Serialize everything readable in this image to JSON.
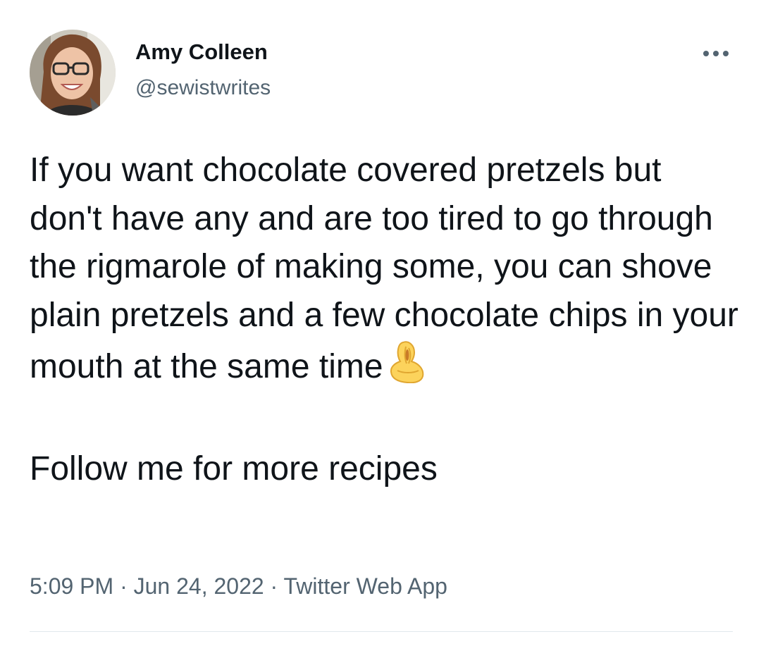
{
  "author": {
    "display_name": "Amy Colleen",
    "handle": "@sewistwrites",
    "avatar_icon": "profile-photo-avatar"
  },
  "more_icon": "more-horizontal-icon",
  "tweet": {
    "paragraph_1": "If you want chocolate covered pretzels but don't have any and are too tired to go through the rigmarole of making some, you can shove plain pretzels and a few chocolate chips in your mouth at the same time",
    "emoji": "pinched-fingers-emoji",
    "paragraph_2": "Follow me for more recipes"
  },
  "meta": {
    "time": "5:09 PM",
    "separator": "·",
    "date": "Jun 24, 2022",
    "source": "Twitter Web App"
  },
  "colors": {
    "text_primary": "#0f1419",
    "text_secondary": "#536471",
    "divider": "#e1e8ed"
  }
}
